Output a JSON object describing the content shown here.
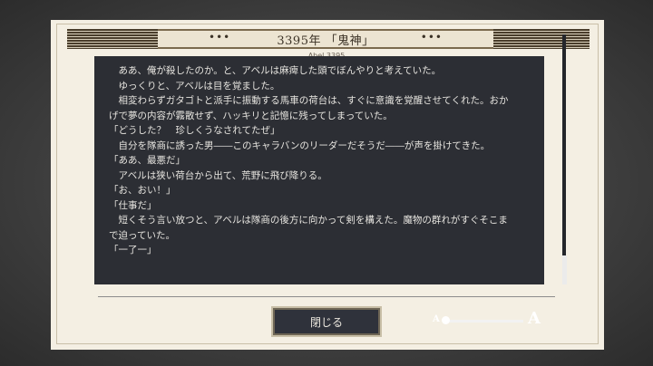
{
  "window": {
    "title": "3395年 「鬼神」",
    "subtitle": "Abel 3395",
    "ornament_left": "•••",
    "ornament_right": "•••"
  },
  "story_lines": [
    "　ああ、俺が殺したのか。と、アベルは麻痺した頭でぼんやりと考えていた。",
    "",
    "　ゆっくりと、アベルは目を覚ました。",
    "　相変わらずガタゴトと派手に振動する馬車の荷台は、すぐに意識を覚醒させてくれた。おか",
    "げで夢の内容が霧散せず、ハッキリと記憶に残ってしまっていた。",
    "「どうした？　珍しくうなされてたぜ」",
    "　自分を隊商に誘った男――このキャラバンのリーダーだそうだ――が声を掛けてきた。",
    "「ああ、最悪だ」",
    "　アベルは狭い荷台から出て、荒野に飛び降りる。",
    "「お、おい！」",
    "「仕事だ」",
    "　短くそう言い放つと、アベルは隊商の後方に向かって剣を構えた。魔物の群れがすぐそこま",
    "で迫っていた。",
    "",
    "「一了一」"
  ],
  "buttons": {
    "close_label": "閉じる"
  },
  "font_size": {
    "small_label": "A",
    "large_label": "A",
    "level": 0.0
  },
  "scroll": {
    "position": 1.0
  }
}
